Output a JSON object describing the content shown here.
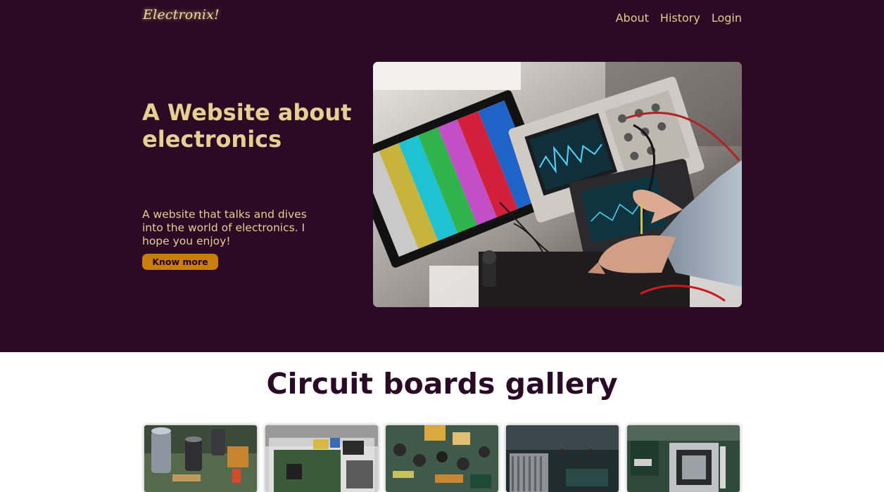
{
  "header": {
    "logo": "Electronix!",
    "nav": [
      {
        "label": "About"
      },
      {
        "label": "History"
      },
      {
        "label": "Login"
      }
    ]
  },
  "hero": {
    "title": "A Website about electronics",
    "description": "A website that talks and dives into the world of electronics. I hope you enjoy!",
    "button_label": "Know more"
  },
  "gallery": {
    "title": "Circuit boards gallery",
    "items": [
      {
        "subject": "capacitors-photo"
      },
      {
        "subject": "raspberry-pi-photo"
      },
      {
        "subject": "power-board-photo"
      },
      {
        "subject": "motherboard-photo"
      },
      {
        "subject": "cpu-socket-photo"
      }
    ]
  },
  "colors": {
    "hero_bg": "#2a0a24",
    "accent_text": "#e6cf90",
    "button": "#c97d0b",
    "gallery_title": "#2a0a24"
  }
}
